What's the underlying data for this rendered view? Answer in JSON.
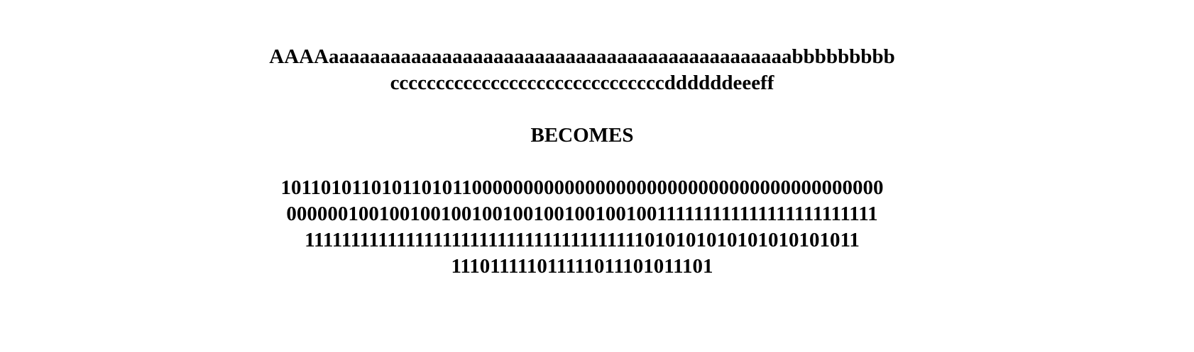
{
  "source_text": {
    "lines": [
      "AAAAaaaaaaaaaaaaaaaaaaaaaaaaaaaaaaaaaaaaaaaaaaaaabbbbbbbbb",
      "ccccccccccccccccccccccccccccccddddddeeeff"
    ]
  },
  "separator_label": "BECOMES",
  "encoded_text": {
    "lines": [
      "10110101101011010110000000000000000000000000000000000000000",
      "000000100100100100100100100100100100111111111111111111111111",
      "1111111111111111111111111111111111111010101010101010101011",
      "111011111011111011101011101"
    ]
  }
}
